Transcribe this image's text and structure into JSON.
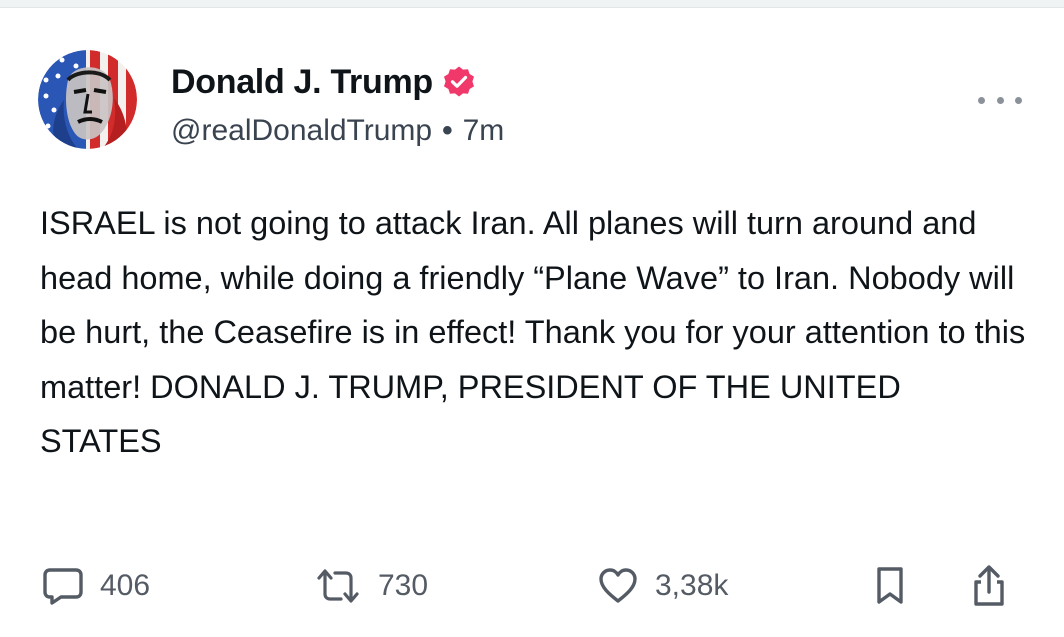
{
  "author": {
    "display_name": "Donald J. Trump",
    "handle": "@realDonaldTrump",
    "separator": "•",
    "time": "7m",
    "verified": true,
    "verified_color": "#f0386b",
    "avatar_icon": "avatar-portrait-flag"
  },
  "post": {
    "text": "ISRAEL is not going to attack Iran. All planes will turn around and head home, while doing a friendly “Plane Wave” to Iran. Nobody will be hurt, the Ceasefire is in effect! Thank you for your attention to this matter! DONALD J. TRUMP, PRESIDENT OF THE UNITED STATES"
  },
  "actions": {
    "reply": {
      "icon": "reply-icon",
      "count": "406"
    },
    "repost": {
      "icon": "repost-icon",
      "count": "730"
    },
    "like": {
      "icon": "heart-icon",
      "count": "3,38k"
    },
    "bookmark": {
      "icon": "bookmark-icon"
    },
    "share": {
      "icon": "share-icon"
    }
  },
  "colors": {
    "text": "#0f1419",
    "secondary": "#545b64",
    "verified": "#f0386b"
  }
}
